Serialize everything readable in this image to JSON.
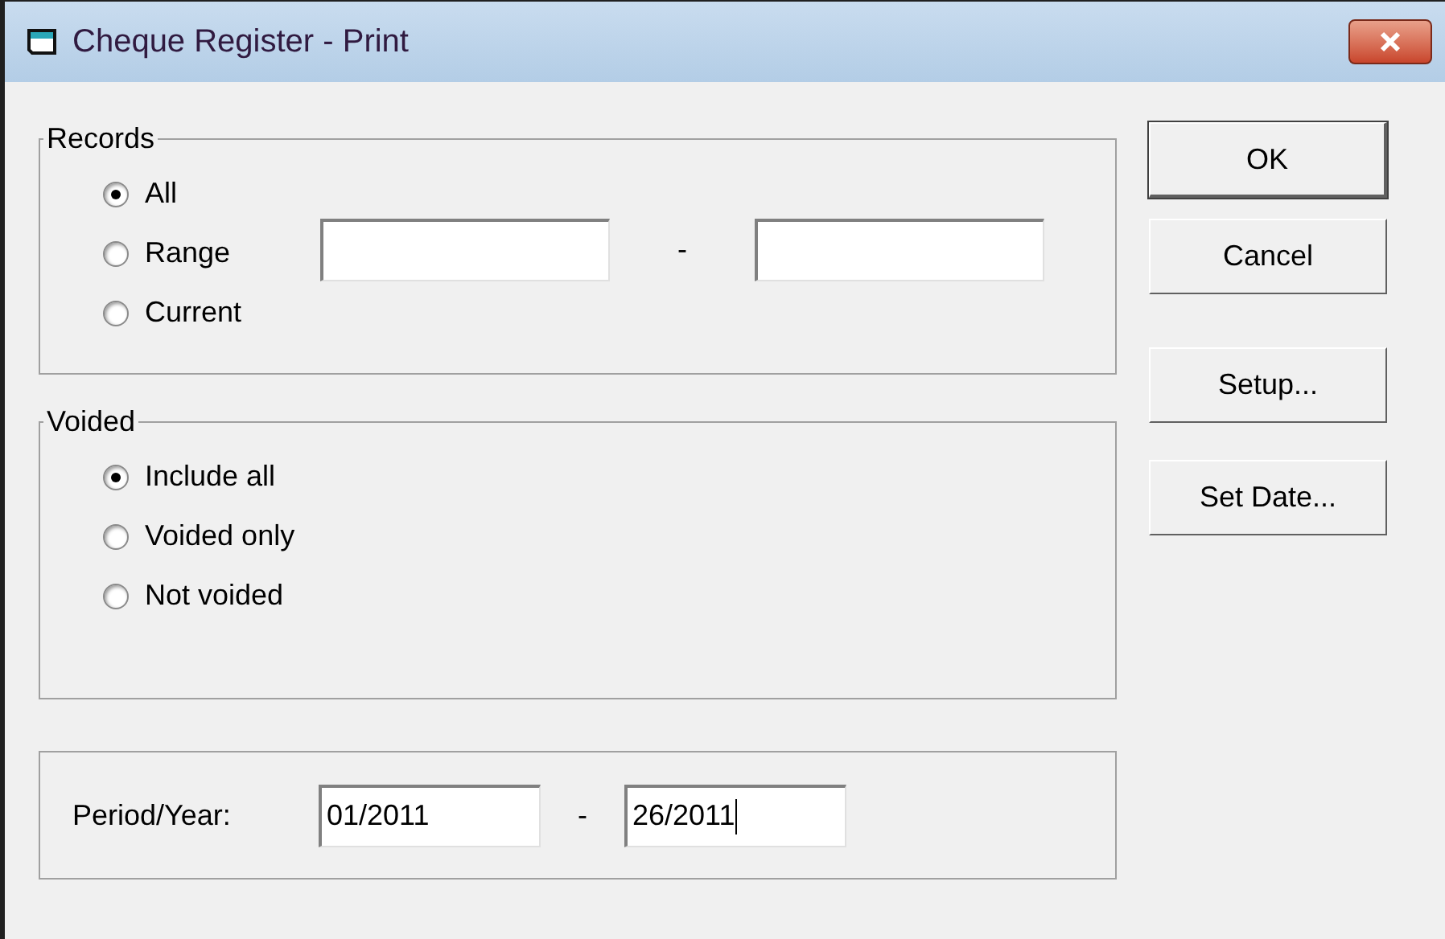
{
  "window": {
    "title": "Cheque Register - Print"
  },
  "records": {
    "label": "Records",
    "options": [
      {
        "label": "All",
        "selected": true
      },
      {
        "label": "Range",
        "selected": false
      },
      {
        "label": "Current",
        "selected": false
      }
    ],
    "range_separator": "-"
  },
  "voided": {
    "label": "Voided",
    "options": [
      {
        "label": "Include all",
        "selected": true
      },
      {
        "label": "Voided only",
        "selected": false
      },
      {
        "label": "Not voided",
        "selected": false
      }
    ]
  },
  "period": {
    "label": "Period/Year:",
    "from": {
      "value": "01/2011",
      "focused": false
    },
    "separator": "-",
    "to": {
      "value": "26/2011",
      "focused": true
    }
  },
  "buttons": [
    {
      "label": "OK",
      "default": true
    },
    {
      "label": "Cancel",
      "default": false
    },
    {
      "label": "Setup...",
      "default": false
    },
    {
      "label": "Set Date...",
      "default": false
    }
  ]
}
